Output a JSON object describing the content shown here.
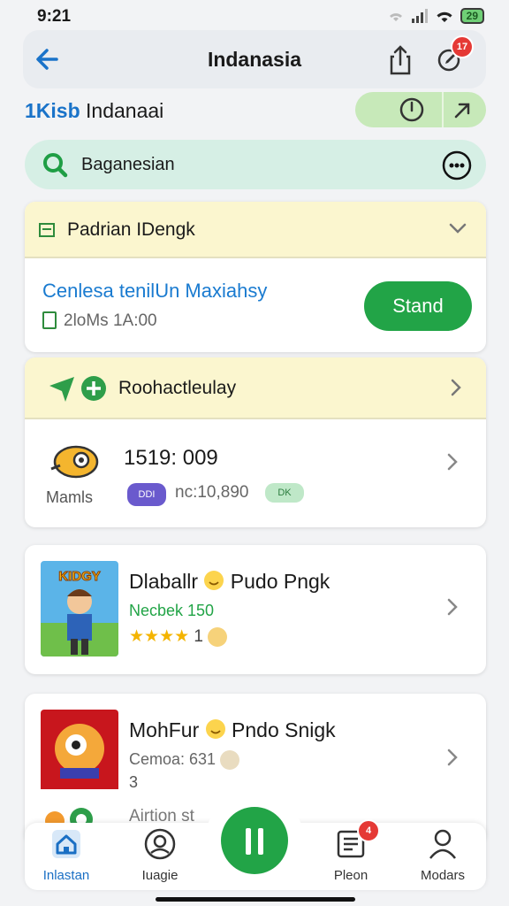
{
  "status_bar": {
    "time": "9:21",
    "battery": "29"
  },
  "header": {
    "title": "Indanasia",
    "edit_badge": "17"
  },
  "subheader": {
    "prefix": "1Kisb",
    "label": "Indanaai"
  },
  "search": {
    "placeholder": "Baganesian"
  },
  "event_card": {
    "header": "Padrian IDengk",
    "title": "Cenlesa tenilUn Maxiahsy",
    "time": "2loMs 1A:00",
    "button": "Stand"
  },
  "stats_card": {
    "header": "Roohactleulay",
    "mascot_label": "Mamls",
    "value": "1519: 009",
    "tag": "DDI",
    "count": "nc:10,890",
    "tag2": "DK"
  },
  "games": [
    {
      "title": "Dlaballr",
      "title2": "Pudo Pngk",
      "sub": "Necbek 150",
      "rating_count": "1",
      "thumb_text": "KIDGY"
    },
    {
      "title": "MohFur",
      "title2": "Pndo Snigk",
      "sub": "Cemoa: 631",
      "extra": "3",
      "row3": "Airtion st"
    }
  ],
  "tabbar": [
    {
      "label": "Inlastan"
    },
    {
      "label": "Iuagie"
    },
    {
      "label": "Pleon",
      "badge": "4"
    },
    {
      "label": "Modars"
    }
  ],
  "colors": {
    "accent_green": "#22a447",
    "accent_blue": "#1a73c9",
    "badge_red": "#e53935"
  }
}
